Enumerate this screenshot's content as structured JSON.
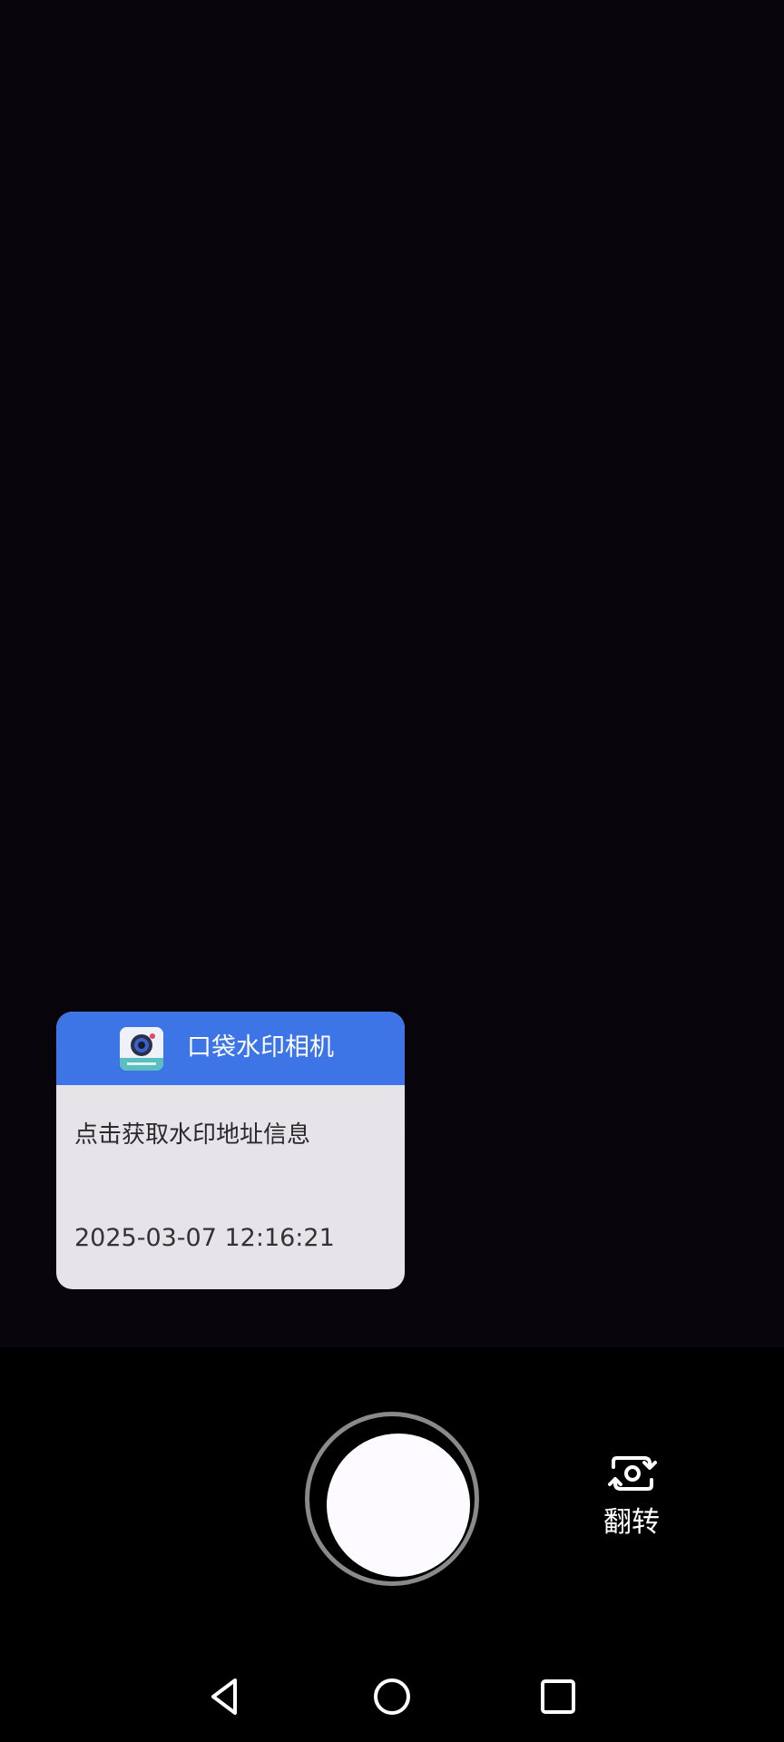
{
  "watermark_card": {
    "app_name": "口袋水印相机",
    "address_prompt": "点击获取水印地址信息",
    "datetime": "2025-03-07 12:16:21",
    "header_color": "#3d74e6",
    "body_color": "#e7e4e9",
    "icon": "camera-app-icon"
  },
  "camera_controls": {
    "shutter_icon": "shutter-button",
    "flip_label": "翻转",
    "flip_icon": "flip-camera-icon"
  },
  "nav_bar": {
    "back_icon": "back-triangle-icon",
    "home_icon": "home-circle-icon",
    "recents_icon": "recents-square-icon"
  }
}
